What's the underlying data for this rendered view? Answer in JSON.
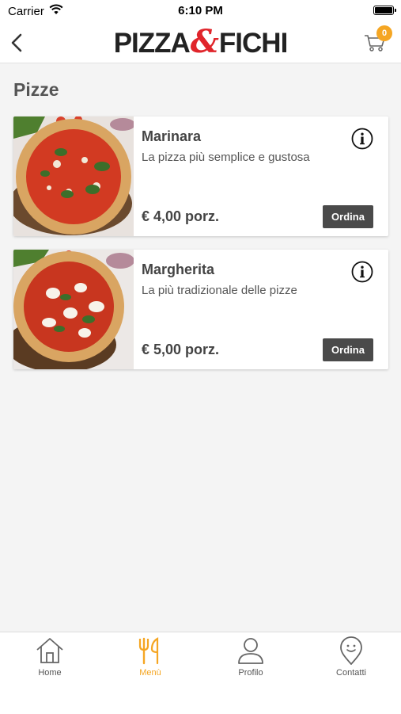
{
  "status_bar": {
    "carrier": "Carrier",
    "time": "6:10 PM"
  },
  "header": {
    "logo_left": "PIZZA",
    "logo_amp": "&",
    "logo_right": "FICHI",
    "cart_count": "0"
  },
  "section_title": "Pizze",
  "items": [
    {
      "name": "Marinara",
      "description": "La pizza più semplice e gustosa",
      "price": "€ 4,00 porz.",
      "order_label": "Ordina"
    },
    {
      "name": "Margherita",
      "description": "La più tradizionale delle pizze",
      "price": "€ 5,00 porz.",
      "order_label": "Ordina"
    }
  ],
  "tabs": [
    {
      "label": "Home",
      "icon": "home-icon",
      "active": false
    },
    {
      "label": "Menù",
      "icon": "fork-knife-icon",
      "active": true
    },
    {
      "label": "Profilo",
      "icon": "user-icon",
      "active": false
    },
    {
      "label": "Contatti",
      "icon": "location-pin-icon",
      "active": false
    }
  ],
  "colors": {
    "accent": "#f5a623",
    "brand_red": "#e0252b",
    "button_dark": "#4a4a4a"
  }
}
